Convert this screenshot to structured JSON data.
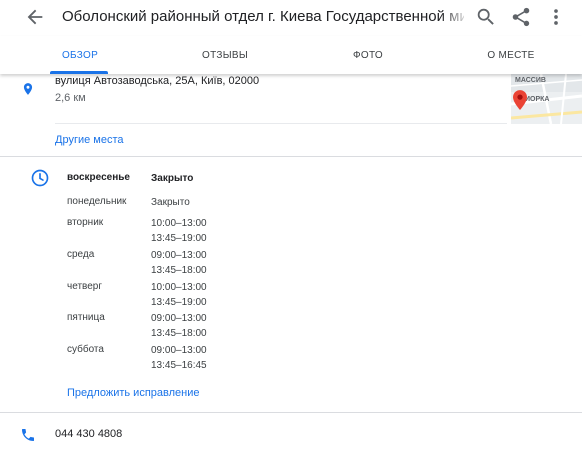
{
  "header": {
    "title": "Оболонский районный отдел г. Киева Государственной миграционной службы"
  },
  "tabs": [
    {
      "label": "ОБЗОР",
      "active": true
    },
    {
      "label": "ОТЗЫВЫ",
      "active": false
    },
    {
      "label": "ФОТО",
      "active": false
    },
    {
      "label": "О МЕСТЕ",
      "active": false
    }
  ],
  "address": {
    "line": "вулиця Автозаводська, 25А, Київ, 02000",
    "distance": "2,6 км",
    "map_labels": [
      "МАССИВ",
      "ИОРКА"
    ],
    "other_places": "Другие места"
  },
  "hours": {
    "rows": [
      {
        "day": "воскресенье",
        "times": [
          "Закрыто"
        ],
        "today": true
      },
      {
        "day": "понедельник",
        "times": [
          "Закрыто"
        ],
        "today": false
      },
      {
        "day": "вторник",
        "times": [
          "10:00–13:00",
          "13:45–19:00"
        ],
        "today": false
      },
      {
        "day": "среда",
        "times": [
          "09:00–13:00",
          "13:45–18:00"
        ],
        "today": false
      },
      {
        "day": "четверг",
        "times": [
          "10:00–13:00",
          "13:45–19:00"
        ],
        "today": false
      },
      {
        "day": "пятница",
        "times": [
          "09:00–13:00",
          "13:45–18:00"
        ],
        "today": false
      },
      {
        "day": "суббота",
        "times": [
          "09:00–13:00",
          "13:45–16:45"
        ],
        "today": false
      }
    ],
    "suggest_edit": "Предложить исправление"
  },
  "phone": {
    "number": "044 430 4808"
  },
  "colors": {
    "accent": "#1a73e8",
    "pin_red": "#ea4335"
  }
}
